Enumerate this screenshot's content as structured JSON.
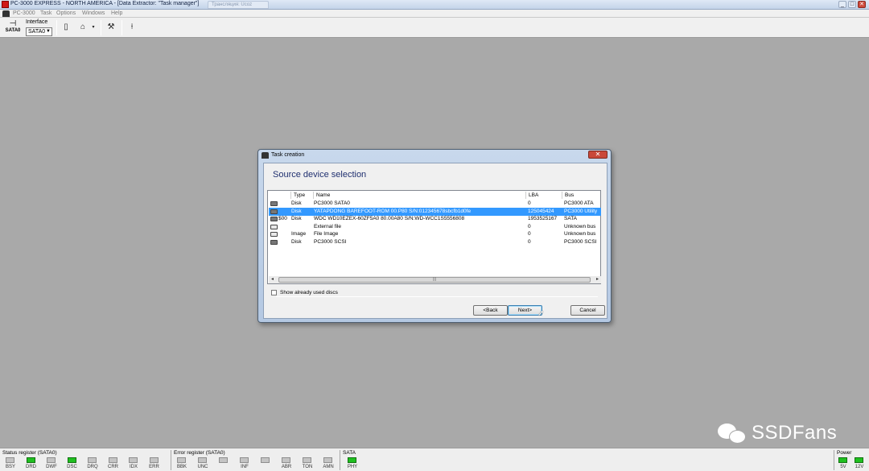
{
  "window": {
    "title": "PC-3000 EXPRESS - NORTH AMERICA - [Data Extractor: \"Task manager\"]",
    "background_tab": "Трансляция: Ucoz",
    "controls": [
      "_",
      "□",
      "✕"
    ]
  },
  "menu": {
    "items": [
      "PC-3000",
      "Task",
      "Options",
      "Windows",
      "Help"
    ]
  },
  "toolbar": {
    "sata_label": "SATA0",
    "interface_label": "Interface",
    "interface_value": "SATA0"
  },
  "dialog": {
    "title": "Task creation",
    "heading": "Source device selection",
    "columns": [
      "Type",
      "Name",
      "LBA",
      "Bus"
    ],
    "rows": [
      {
        "icon": "disk-icon",
        "prefix": "",
        "type": "Disk",
        "name": "PC3000 SATA0",
        "lba": "0",
        "bus": "PC3000 ATA",
        "selected": false
      },
      {
        "icon": "disk-icon",
        "prefix": "",
        "type": "Disk",
        "name": "YATAPDONG BAREFOOT-ROM 00.P80 S/N:012345678sbcfb1d0fe",
        "lba": "125045424",
        "bus": "PC3000 Utility",
        "selected": true
      },
      {
        "icon": "disk-icon",
        "prefix": "$00",
        "type": "Disk",
        "name": "WDC WD10EZEX-60ZF5A0 80.00A80 S/N:WD-WCC1S5556808",
        "lba": "1953525167",
        "bus": "SATA",
        "selected": false
      },
      {
        "icon": "image-icon",
        "prefix": "",
        "type": "",
        "name": "External file",
        "lba": "0",
        "bus": "Unknown bus",
        "selected": false
      },
      {
        "icon": "image-icon",
        "prefix": "",
        "type": "Image",
        "name": "File Image",
        "lba": "0",
        "bus": "Unknown bus",
        "selected": false
      },
      {
        "icon": "disk-icon",
        "prefix": "",
        "type": "Disk",
        "name": "PC3000 SCSI",
        "lba": "0",
        "bus": "PC3000 SCSI",
        "selected": false
      }
    ],
    "scroll_grip": "|||",
    "show_used_label": "Show already used discs",
    "buttons": {
      "back": "<Back",
      "next": "Next>",
      "cancel": "Cancel"
    }
  },
  "status": {
    "status_register": {
      "title": "Status register (SATA0)",
      "leds": [
        {
          "label": "BSY",
          "on": false
        },
        {
          "label": "DRD",
          "on": true
        },
        {
          "label": "DWF",
          "on": false
        },
        {
          "label": "DSC",
          "on": true
        },
        {
          "label": "DRQ",
          "on": false
        },
        {
          "label": "CRR",
          "on": false
        },
        {
          "label": "IDX",
          "on": false
        },
        {
          "label": "ERR",
          "on": false
        }
      ]
    },
    "error_register": {
      "title": "Error register (SATA0)",
      "leds": [
        {
          "label": "BBK",
          "on": false
        },
        {
          "label": "UNC",
          "on": false
        },
        {
          "label": "",
          "on": false
        },
        {
          "label": "INF",
          "on": false
        },
        {
          "label": "",
          "on": false
        },
        {
          "label": "ABR",
          "on": false
        },
        {
          "label": "TON",
          "on": false
        },
        {
          "label": "AMN",
          "on": false
        }
      ]
    },
    "sata": {
      "title": "SATA",
      "leds": [
        {
          "label": "PHY",
          "on": true
        }
      ]
    },
    "power": {
      "title": "Power",
      "leds": [
        {
          "label": "5V",
          "on": true
        },
        {
          "label": "12V",
          "on": true
        }
      ]
    }
  },
  "watermark": {
    "text": "SSDFans"
  },
  "colors": {
    "selection": "#3399ff",
    "led_on": "#20c020",
    "led_off": "#c4c4c4",
    "desktop": "#a9a9a9"
  }
}
